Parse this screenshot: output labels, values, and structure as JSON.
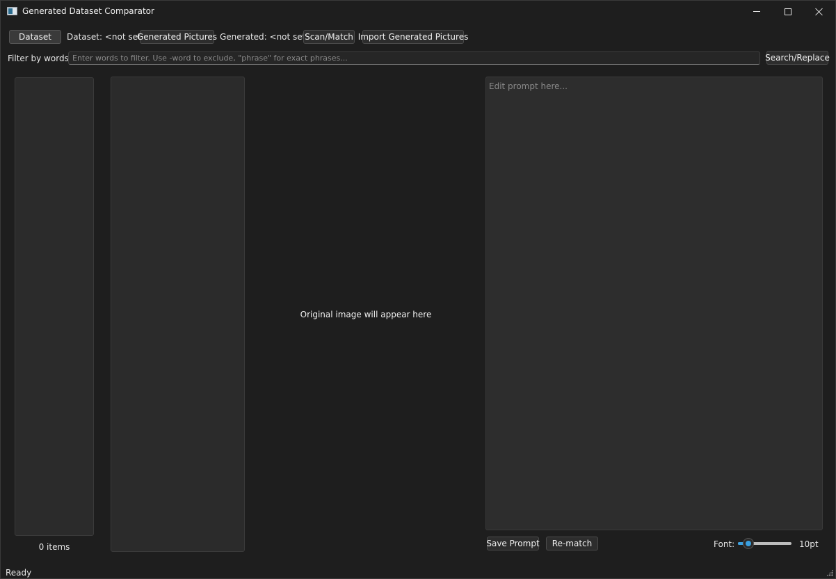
{
  "window": {
    "title": "Generated Dataset Comparator"
  },
  "toolbar": {
    "dataset_button": "Dataset",
    "dataset_label": "Dataset: <not set>",
    "generated_pictures_button": "Generated Pictures",
    "generated_label": "Generated: <not set>",
    "scan_match_button": "Scan/Match",
    "import_button": "Import Generated Pictures"
  },
  "filter": {
    "label": "Filter by words:",
    "placeholder": "Enter words to filter. Use -word to exclude, \"phrase\" for exact phrases...",
    "value": "",
    "search_replace_button": "Search/Replace"
  },
  "dataset_list": {
    "count_label": "0 items"
  },
  "image_viewer": {
    "placeholder": "Original image will appear here"
  },
  "prompt_editor": {
    "placeholder": "Edit prompt here...",
    "value": "",
    "save_button": "Save Prompt",
    "rematch_button": "Re-match"
  },
  "font_control": {
    "label": "Font:",
    "value_label": "10pt",
    "slider_fraction": 0.2
  },
  "status": {
    "text": "Ready"
  },
  "colors": {
    "accent": "#3aa0e0",
    "background": "#1e1e1e",
    "panel": "#2b2b2b"
  }
}
